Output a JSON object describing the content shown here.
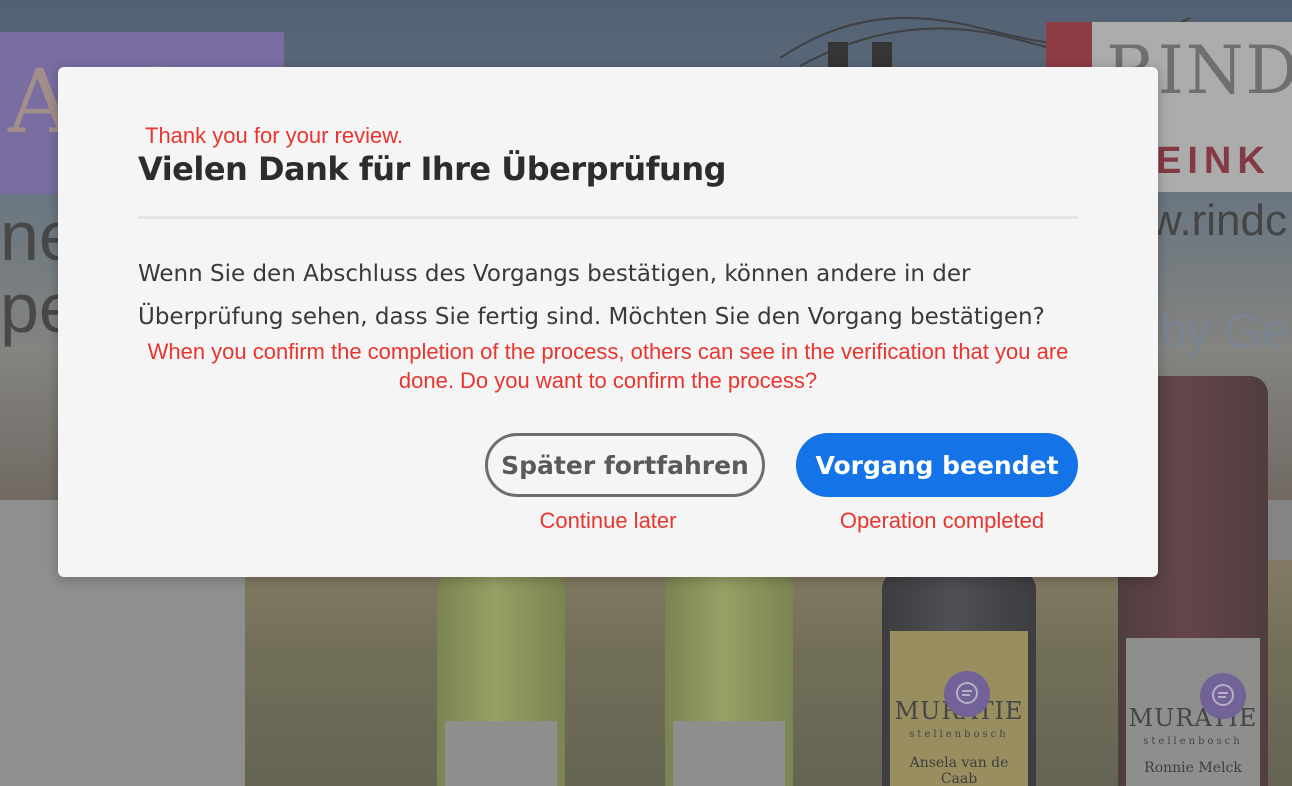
{
  "background": {
    "purple_panel_text": "ArCHA",
    "left_words": [
      "ne",
      "pe"
    ],
    "banner_title": "RINDC",
    "banner_subtitle": "EINK",
    "url_text": "w.rindc",
    "byline_text": "by Ge",
    "bottles": [
      {
        "brand": "",
        "sub": "",
        "name": ""
      },
      {
        "brand": "",
        "sub": "",
        "name": ""
      },
      {
        "brand": "MURATIE",
        "sub": "stellenbosch",
        "name": "Ansela van de Caab"
      },
      {
        "brand": "MURATIE",
        "sub": "stellenbosch",
        "name": "Ronnie Melck"
      }
    ]
  },
  "dialog": {
    "annotation_title": "Thank you for your review.",
    "title": "Vielen Dank für Ihre Überprüfung",
    "body": "Wenn Sie den Abschluss des Vorgangs bestätigen, können andere in der Überprüfung sehen, dass Sie fertig sind. Möchten Sie den Vorgang bestätigen?",
    "annotation_body": "When you confirm the completion of the process, others can see in the verification that you are done. Do you want to confirm the process?",
    "secondary_button": "Später fortfahren",
    "primary_button": "Vorgang beendet",
    "annotation_secondary": "Continue later",
    "annotation_primary": "Operation completed"
  },
  "colors": {
    "primary_button": "#1473e6",
    "annotation_red": "#e8352f",
    "dialog_bg": "#f5f5f5"
  }
}
